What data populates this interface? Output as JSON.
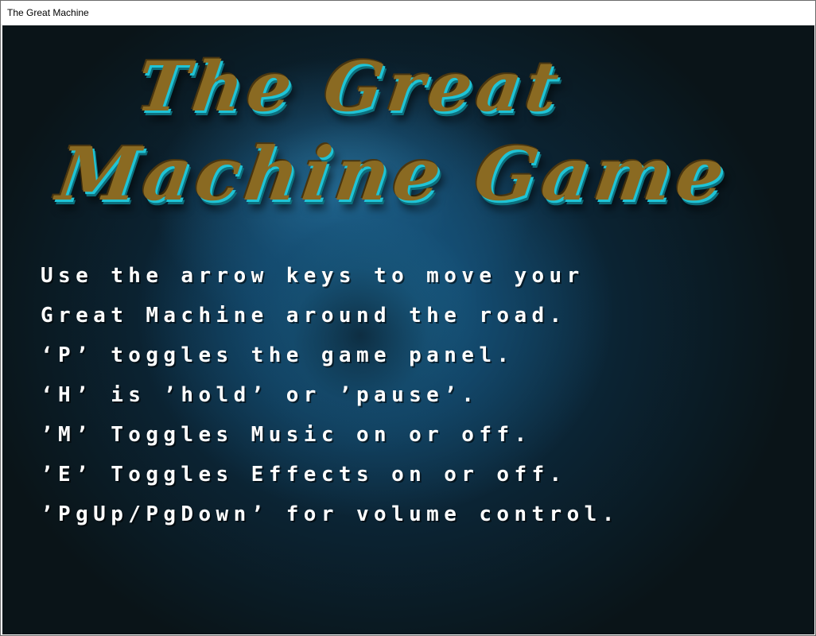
{
  "window": {
    "title": "The Great Machine"
  },
  "logo": {
    "line1": "The Great",
    "line2": "Machine Game"
  },
  "instructions": [
    "Use the arrow keys to move your",
    "Great Machine around the road.",
    "‘P’ toggles the game panel.",
    "‘H’ is ’hold’ or ’pause’.",
    "’M’ Toggles Music on or off.",
    "’E’ Toggles Effects on or off.",
    "’PgUp/PgDown’ for volume control."
  ]
}
